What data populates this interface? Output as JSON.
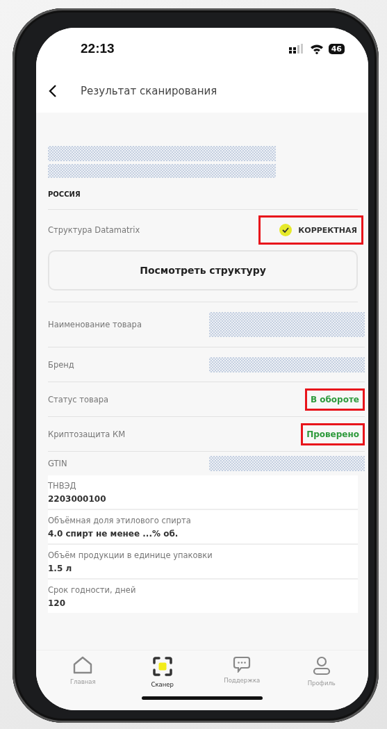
{
  "status_bar": {
    "time": "22:13",
    "battery": "46"
  },
  "header": {
    "title": "Результат сканирования"
  },
  "country": "РОССИЯ",
  "structure": {
    "label": "Структура Datamatrix",
    "value": "КОРРЕКТНАЯ",
    "highlighted": true
  },
  "structure_button": "Посмотреть структуру",
  "fields": [
    {
      "label": "Наименование товара",
      "kind": "redacted"
    },
    {
      "label": "Бренд",
      "kind": "redacted"
    },
    {
      "label": "Статус товара",
      "kind": "status",
      "value": "В обороте",
      "highlighted": true
    },
    {
      "label": "Криптозащита КМ",
      "kind": "status",
      "value": "Проверено",
      "highlighted": true
    },
    {
      "label": "GTIN",
      "kind": "redacted"
    }
  ],
  "cards": [
    {
      "label": "ТНВЭД",
      "value": "2203000100"
    },
    {
      "label": "Объёмная доля этилового спирта",
      "value": "4.0 спирт не менее ...% об."
    },
    {
      "label": "Объём продукции в единице упаковки",
      "value": "1.5 л"
    },
    {
      "label": "Срок годности, дней",
      "value": "120"
    }
  ],
  "tabs": [
    {
      "label": "Главная",
      "selected": false
    },
    {
      "label": "Сканер",
      "selected": true
    },
    {
      "label": "Поддержка",
      "selected": false
    },
    {
      "label": "Профиль",
      "selected": false
    }
  ]
}
